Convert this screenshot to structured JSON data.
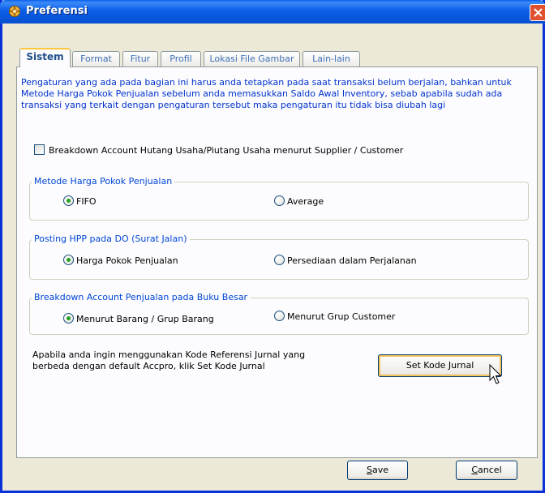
{
  "window": {
    "title": "Preferensi",
    "icon": "app-icon"
  },
  "tabs": [
    {
      "label": "Sistem",
      "active": true
    },
    {
      "label": "Format",
      "active": false
    },
    {
      "label": "Fitur",
      "active": false
    },
    {
      "label": "Profil",
      "active": false
    },
    {
      "label": "Lokasi File Gambar",
      "active": false
    },
    {
      "label": "Lain-lain",
      "active": false
    }
  ],
  "intro_text": "Pengaturan yang ada pada bagian ini harus anda tetapkan pada saat transaksi belum berjalan, bahkan untuk Metode Harga Pokok Penjualan sebelum anda memasukkan Saldo Awal Inventory, sebab apabila sudah ada transaksi yang terkait dengan pengaturan tersebut maka pengaturan itu tidak bisa diubah lagi",
  "breakdown_checkbox": {
    "label": "Breakdown Account Hutang Usaha/Piutang Usaha menurut Supplier / Customer",
    "checked": false
  },
  "groups": [
    {
      "legend": "Metode Harga Pokok Penjualan",
      "options": [
        {
          "label": "FIFO",
          "checked": true
        },
        {
          "label": "Average",
          "checked": false
        }
      ]
    },
    {
      "legend": "Posting HPP pada DO (Surat Jalan)",
      "options": [
        {
          "label": "Harga Pokok Penjualan",
          "checked": true
        },
        {
          "label": "Persediaan dalam Perjalanan",
          "checked": false
        }
      ]
    },
    {
      "legend": "Breakdown Account Penjualan pada Buku Besar",
      "options": [
        {
          "label": "Menurut Barang / Grup Barang",
          "checked": true
        },
        {
          "label": "Menurut Grup Customer",
          "checked": false
        }
      ]
    }
  ],
  "kode_jurnal": {
    "text_line1": "Apabila anda ingin menggunakan Kode Referensi Jurnal yang",
    "text_line2": "berbeda dengan default Accpro, klik Set Kode Jurnal",
    "button": "Set Kode Jurnal"
  },
  "buttons": {
    "save_mnemonic": "S",
    "save_rest": "ave",
    "cancel_mnemonic": "C",
    "cancel_rest": "ancel"
  },
  "colors": {
    "titlebar": "#0a5ee6",
    "intro_text": "#0033cc",
    "legend_text": "#0046d5",
    "active_tab_highlight": "#ffc83c",
    "radio_checked": "#21a121"
  }
}
